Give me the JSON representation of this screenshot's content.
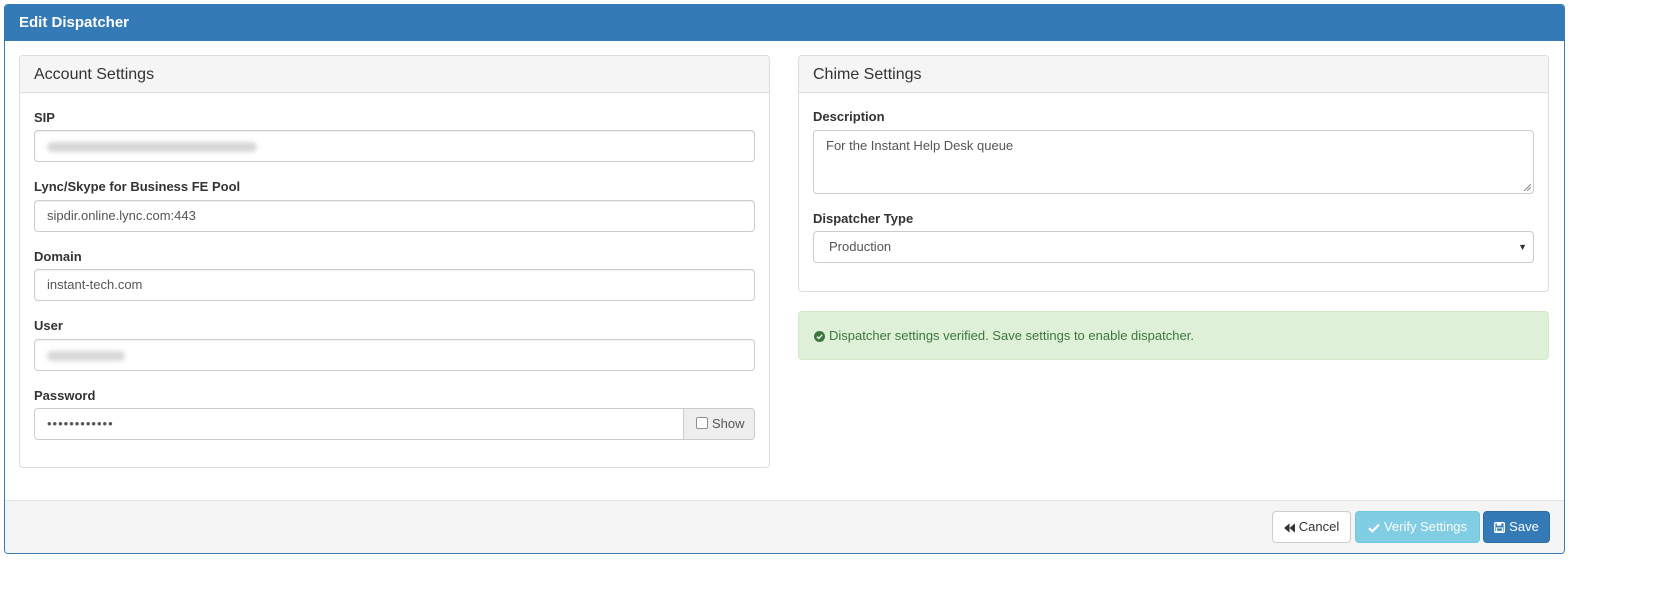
{
  "modal": {
    "title": "Edit Dispatcher"
  },
  "account": {
    "heading": "Account Settings",
    "sip_label": "SIP",
    "sip_value": "",
    "pool_label": "Lync/Skype for Business FE Pool",
    "pool_value": "sipdir.online.lync.com:443",
    "domain_label": "Domain",
    "domain_value": "instant-tech.com",
    "user_label": "User",
    "user_value": "",
    "password_label": "Password",
    "password_value": "••••••••••••",
    "show_label": "Show"
  },
  "chime": {
    "heading": "Chime Settings",
    "description_label": "Description",
    "description_value": "For the Instant Help Desk queue",
    "type_label": "Dispatcher Type",
    "type_value": "Production"
  },
  "alert": {
    "message": "Dispatcher settings verified. Save settings to enable dispatcher."
  },
  "footer": {
    "cancel_label": "Cancel",
    "verify_label": "Verify Settings",
    "save_label": "Save"
  },
  "colors": {
    "primary": "#337ab7",
    "info": "#5bc0de",
    "success_bg": "#dff0d8",
    "success_text": "#3c763d"
  },
  "icons": {
    "cancel": "backward-icon",
    "verify": "check-icon",
    "save": "floppy-disk-icon",
    "alert": "check-circle-icon",
    "select": "caret-down-icon"
  }
}
